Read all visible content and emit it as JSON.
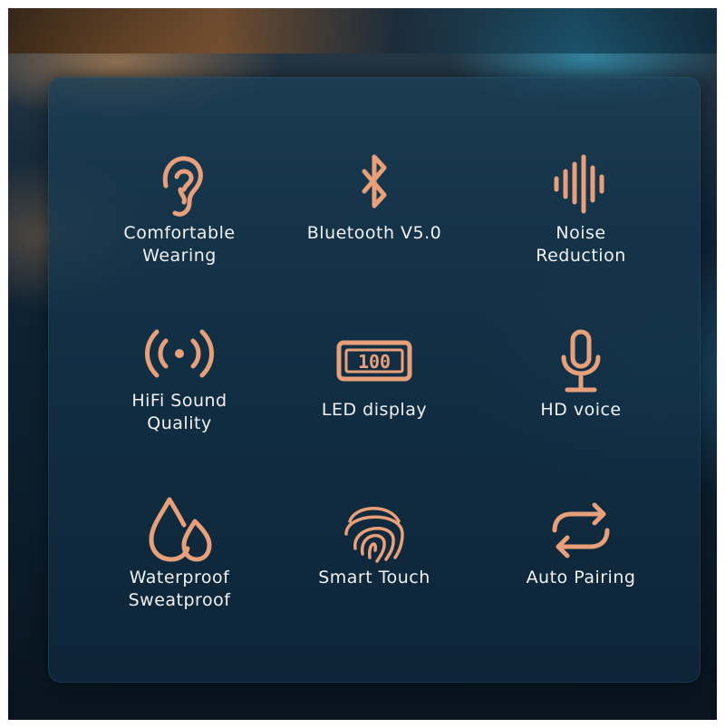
{
  "accent_color": "#e8a07a",
  "text_color": "#f1f1f1",
  "features": [
    {
      "icon": "ear-icon",
      "line1": "Comfortable",
      "line2": "Wearing"
    },
    {
      "icon": "bluetooth-icon",
      "line1": "Bluetooth V5.0",
      "line2": ""
    },
    {
      "icon": "sound-wave-icon",
      "line1": "Noise",
      "line2": "Reduction"
    },
    {
      "icon": "signal-broadcast-icon",
      "line1": "HiFi Sound",
      "line2": "Quality"
    },
    {
      "icon": "led-display-icon",
      "line1": "LED display",
      "line2": "",
      "display_digits": "100"
    },
    {
      "icon": "microphone-icon",
      "line1": "HD voice",
      "line2": ""
    },
    {
      "icon": "water-drops-icon",
      "line1": "Waterproof",
      "line2": "Sweatproof"
    },
    {
      "icon": "fingerprint-icon",
      "line1": "Smart Touch",
      "line2": ""
    },
    {
      "icon": "sync-arrows-icon",
      "line1": "Auto Pairing",
      "line2": ""
    }
  ]
}
